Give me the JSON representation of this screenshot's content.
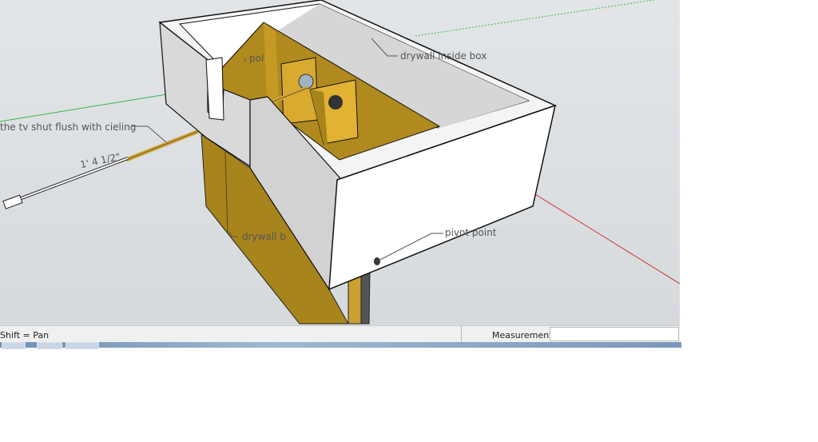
{
  "viewport": {
    "labels": {
      "tv_shut": "the tv shut flush with cieling",
      "dimension": "1' 4 1/2\"",
      "pol": "pol",
      "drywall_inside": "drywall inside box",
      "drywall_b": "drywall b",
      "pivot": "pivot point"
    }
  },
  "statusbar": {
    "hint": "Shift = Pan",
    "measurements_label": "Measurements",
    "measurements_value": ""
  },
  "colors": {
    "wood": "#c9a02a",
    "wood_dark": "#9c7a16",
    "axis_green": "#3cb44a",
    "axis_red": "#d03030"
  }
}
